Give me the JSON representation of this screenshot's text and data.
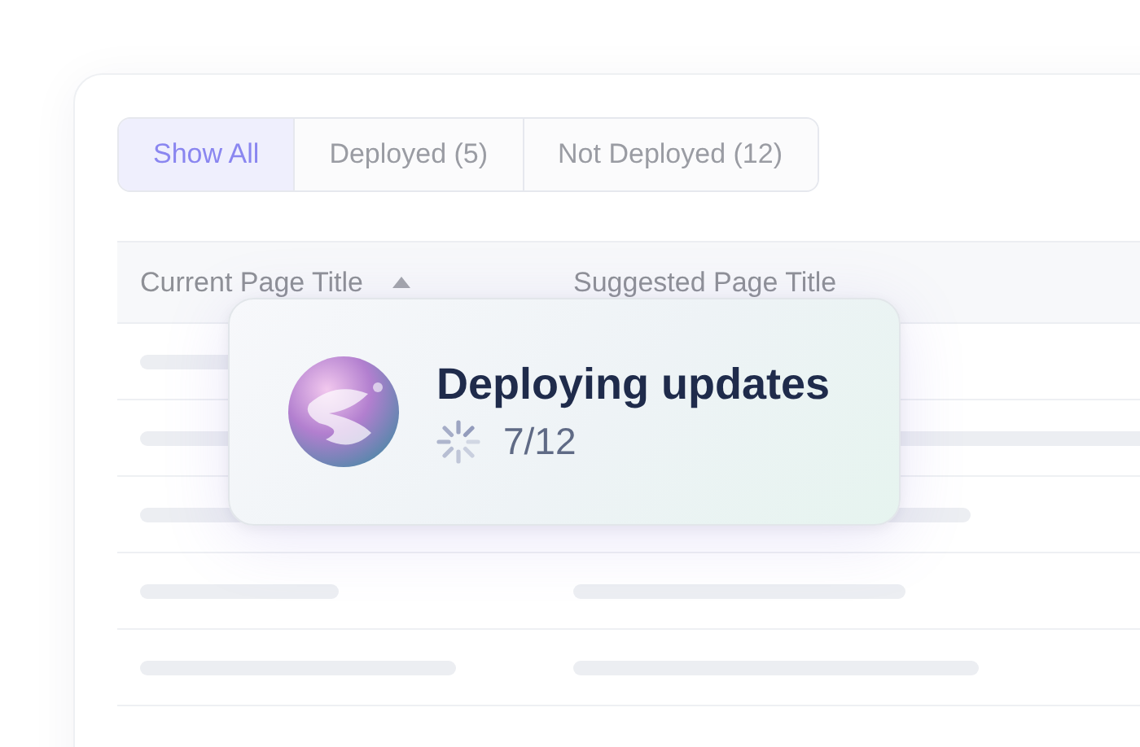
{
  "filter_tabs": [
    {
      "label": "Show All",
      "selected": true
    },
    {
      "label": "Deployed (5)",
      "selected": false
    },
    {
      "label": "Not Deployed (12)",
      "selected": false
    }
  ],
  "table": {
    "columns": [
      {
        "label": "Current Page Title",
        "sorted": true
      },
      {
        "label": "Suggested Page Title",
        "sorted": false
      }
    ]
  },
  "toast": {
    "title": "Deploying updates",
    "progress": "7/12"
  }
}
